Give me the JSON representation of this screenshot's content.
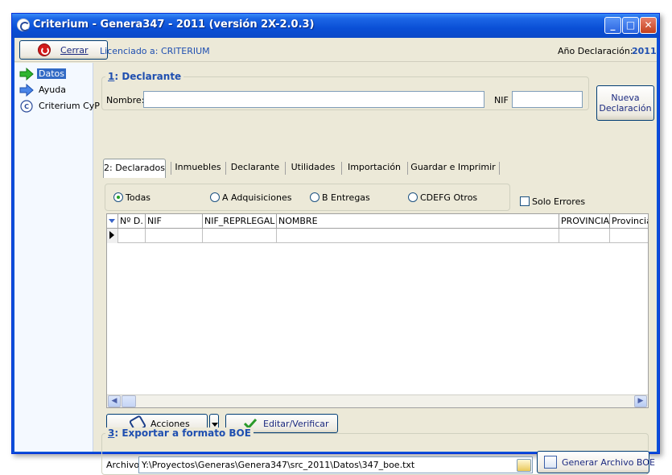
{
  "window": {
    "title": "Criterium - Genera347 - 2011 (versión 2X-2.0.3)",
    "controls": {
      "minimize": "_",
      "maximize": "□",
      "close": "✕"
    }
  },
  "toolbar": {
    "cerrar_label": "Cerrar",
    "licencia": "Licenciado a: CRITERIUM",
    "anio_label": "Año Declaración:",
    "anio_value": "2011"
  },
  "sidebar": {
    "items": [
      {
        "label": "Datos",
        "icon": "arrow-right-green-icon",
        "selected": true
      },
      {
        "label": "Ayuda",
        "icon": "arrow-right-blue-icon",
        "selected": false
      },
      {
        "label": "Criterium CyP",
        "icon": "criterium-cyp-icon",
        "selected": false
      }
    ]
  },
  "declarante": {
    "group_number": "1",
    "group_title": ": Declarante",
    "nombre_label": "Nombre:",
    "nombre_value": "",
    "nif_label": "NIF",
    "nif_value": "",
    "nueva_line1": "Nueva",
    "nueva_line2": "Declaración"
  },
  "tabs": [
    {
      "label": "2: Declarados",
      "active": true
    },
    {
      "label": "Inmuebles",
      "active": false
    },
    {
      "label": "Declarante",
      "active": false
    },
    {
      "label": "Utilidades",
      "active": false
    },
    {
      "label": "Importación",
      "active": false
    },
    {
      "label": "Guardar e Imprimir",
      "active": false
    }
  ],
  "filters": {
    "radios": [
      {
        "label": "Todas",
        "checked": true
      },
      {
        "label": "A Adquisiciones",
        "checked": false
      },
      {
        "label": "B Entregas",
        "checked": false
      },
      {
        "label": "CDEFG  Otros",
        "checked": false
      }
    ],
    "solo_errores_label": "Solo Errores",
    "solo_errores_checked": false
  },
  "grid": {
    "columns": [
      "Nº D.",
      "NIF",
      "NIF_REPRLEGAL",
      "NOMBRE",
      "PROVINCIA",
      "Provincia"
    ],
    "rows": [
      [
        "",
        "",
        "",
        "",
        "",
        ""
      ]
    ]
  },
  "actions": {
    "acciones_label": "Acciones",
    "editar_label": "Editar/Verificar"
  },
  "exportar": {
    "group_number": "3",
    "group_title": ": Exportar a formato BOE",
    "archivo_label": "Archivo",
    "archivo_value": "Y:\\Proyectos\\Generas\\Genera347\\src_2011\\Datos\\347_boe.txt",
    "generar_label": "Generar Archivo BOE"
  },
  "colors": {
    "accent": "#1f4fb0",
    "titlebar": "#0a4fd6",
    "selection": "#316ac5"
  }
}
